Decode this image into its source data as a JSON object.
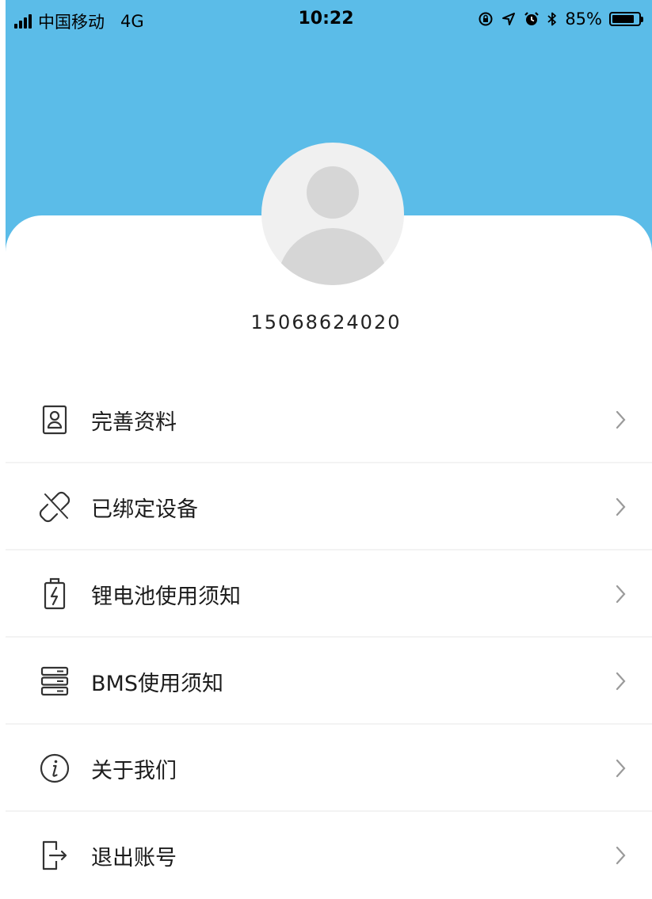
{
  "status_bar": {
    "carrier": "中国移动",
    "network": "4G",
    "time": "10:22",
    "battery_text": "85%",
    "battery_level": 0.85,
    "icons": [
      "orientation-lock-icon",
      "location-icon",
      "alarm-icon",
      "bluetooth-icon"
    ]
  },
  "profile": {
    "phone": "15068624020"
  },
  "menu": {
    "items": [
      {
        "label": "完善资料",
        "icon": "user-card-icon"
      },
      {
        "label": "已绑定设备",
        "icon": "link-broken-icon"
      },
      {
        "label": "锂电池使用须知",
        "icon": "battery-charge-icon"
      },
      {
        "label": "BMS使用须知",
        "icon": "server-stack-icon"
      },
      {
        "label": "关于我们",
        "icon": "info-icon"
      },
      {
        "label": "退出账号",
        "icon": "logout-icon"
      }
    ]
  },
  "colors": {
    "header": "#5bbce8",
    "avatar_bg": "#f0f0f0",
    "avatar_fg": "#d6d6d6",
    "divider": "#f3f3f3"
  }
}
